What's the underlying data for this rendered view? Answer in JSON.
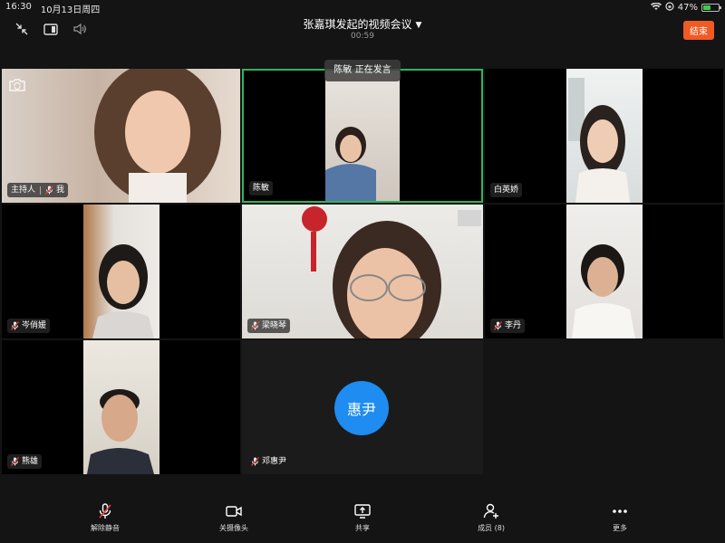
{
  "status_bar": {
    "time": "16:30",
    "date": "10月13日周四",
    "battery": "47%",
    "battery_level": 0.47
  },
  "top_bar": {
    "meeting_title": "张嘉琪发起的视频会议",
    "timer": "00:59",
    "end_button": "结束",
    "icons": [
      "collapse-icon",
      "layout-icon",
      "speaker-icon"
    ]
  },
  "speaking_banner": "陈敏 正在发言",
  "participants": [
    {
      "name": "主持人",
      "self": "我",
      "muted": true
    },
    {
      "name": "陈敏",
      "muted": false
    },
    {
      "name": "白英娇",
      "muted": false
    },
    {
      "name": "岑俏媛",
      "muted": true
    },
    {
      "name": "梁晓琴",
      "muted": true
    },
    {
      "name": "李丹",
      "muted": true
    },
    {
      "name": "熊雄",
      "muted": true
    },
    {
      "name": "邓惠尹",
      "muted": true,
      "avatar_text": "惠尹",
      "avatar_color": "#1e8cf0"
    }
  ],
  "colors": {
    "end": "#f05a24",
    "active_border": "#2fb35e",
    "avatar": "#1e8cf0"
  },
  "bottom_bar": {
    "unmute": "解除静音",
    "camera_off": "关摄像头",
    "share": "共享",
    "members": "成员 (8)",
    "more": "更多"
  }
}
